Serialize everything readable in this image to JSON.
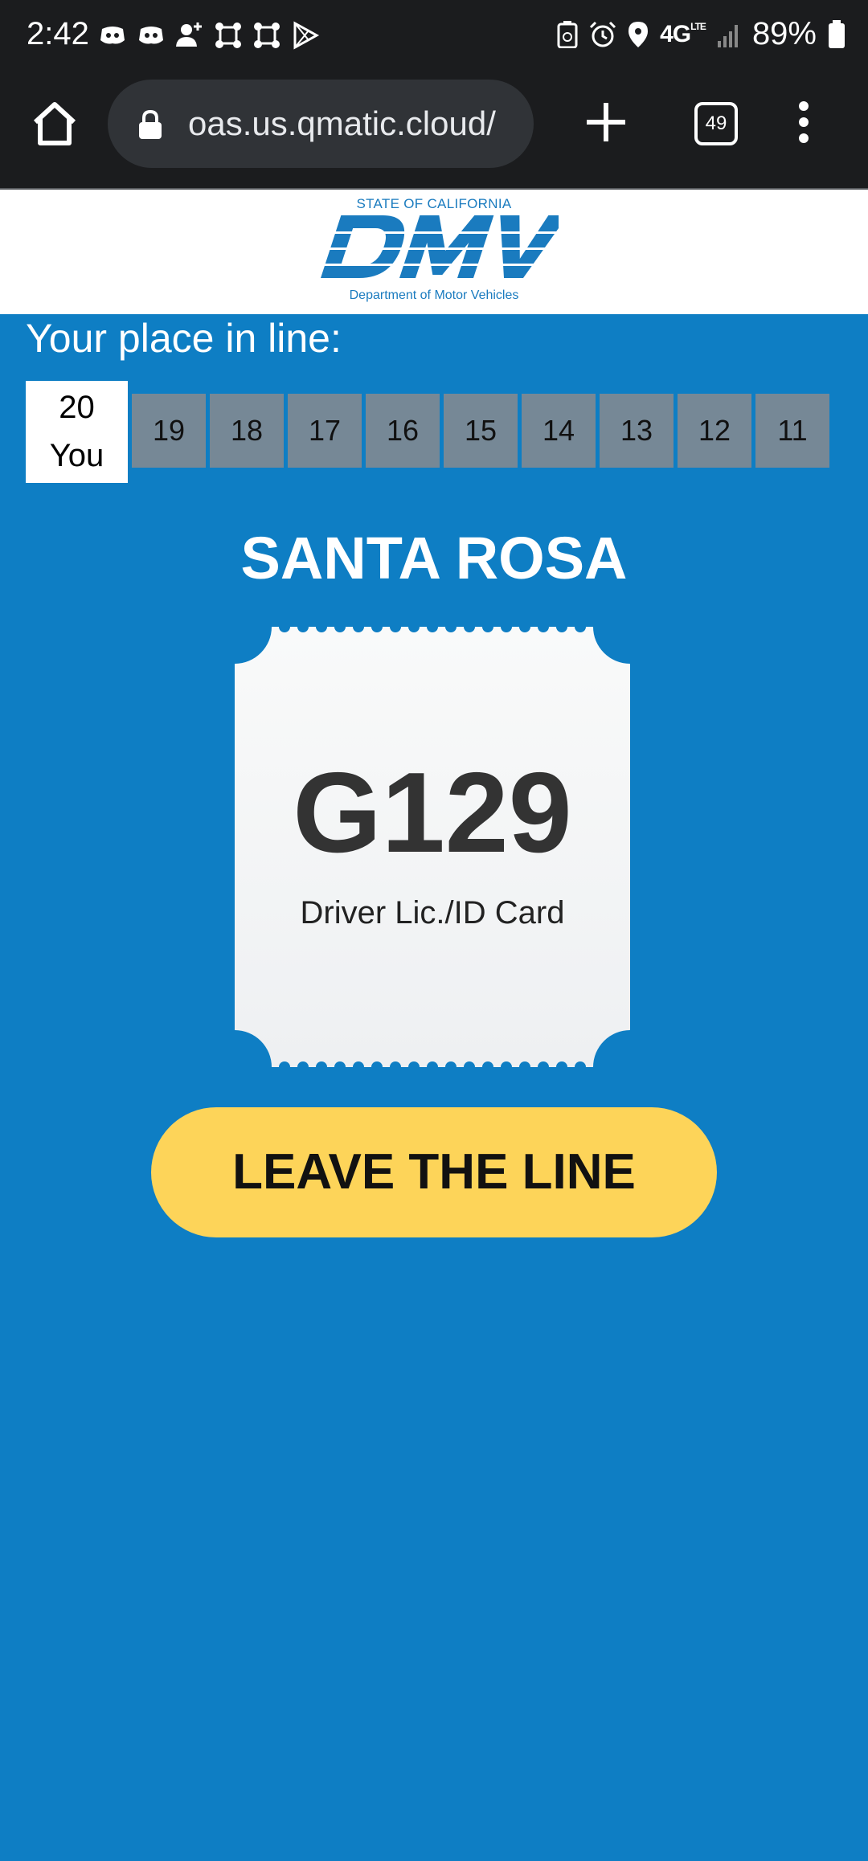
{
  "status_bar": {
    "time": "2:42",
    "network": "4G",
    "network_sub": "LTE",
    "battery": "89%",
    "left_icons": [
      "discord-icon",
      "discord-icon",
      "person-add-icon",
      "hub-icon",
      "hub-icon",
      "play-store-icon"
    ],
    "right_icons": [
      "battery-saver-icon",
      "alarm-icon",
      "location-icon",
      "signal-icon",
      "battery-icon"
    ]
  },
  "browser": {
    "url": "/oas.us.qmatic.cloud",
    "tab_count": "49",
    "icons": [
      "home-icon",
      "lock-icon",
      "plus-icon",
      "tabs-icon",
      "more-icon"
    ]
  },
  "header": {
    "state": "STATE OF CALIFORNIA",
    "brand": "DMV",
    "department": "Department of Motor Vehicles"
  },
  "queue": {
    "label": "Your place in line:",
    "you_position": "20",
    "you_label": "You",
    "ahead": [
      "19",
      "18",
      "17",
      "16",
      "15",
      "14",
      "13",
      "12",
      "11"
    ]
  },
  "branch": {
    "name": "SANTA ROSA"
  },
  "ticket": {
    "number": "G129",
    "service": "Driver Lic./ID Card"
  },
  "actions": {
    "leave_label": "LEAVE THE LINE"
  },
  "colors": {
    "page_bg": "#0e7ec4",
    "bar_bg": "#1b1c1e",
    "queue_cell": "#768896",
    "button": "#fdd459",
    "dmv_blue": "#1a7bbf"
  }
}
